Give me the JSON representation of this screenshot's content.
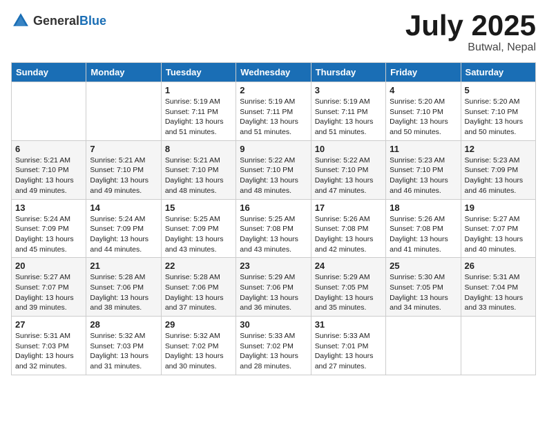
{
  "header": {
    "logo_general": "General",
    "logo_blue": "Blue",
    "month_year": "July 2025",
    "location": "Butwal, Nepal"
  },
  "calendar": {
    "days_of_week": [
      "Sunday",
      "Monday",
      "Tuesday",
      "Wednesday",
      "Thursday",
      "Friday",
      "Saturday"
    ],
    "weeks": [
      [
        {
          "day": "",
          "info": ""
        },
        {
          "day": "",
          "info": ""
        },
        {
          "day": "1",
          "info": "Sunrise: 5:19 AM\nSunset: 7:11 PM\nDaylight: 13 hours\nand 51 minutes."
        },
        {
          "day": "2",
          "info": "Sunrise: 5:19 AM\nSunset: 7:11 PM\nDaylight: 13 hours\nand 51 minutes."
        },
        {
          "day": "3",
          "info": "Sunrise: 5:19 AM\nSunset: 7:11 PM\nDaylight: 13 hours\nand 51 minutes."
        },
        {
          "day": "4",
          "info": "Sunrise: 5:20 AM\nSunset: 7:10 PM\nDaylight: 13 hours\nand 50 minutes."
        },
        {
          "day": "5",
          "info": "Sunrise: 5:20 AM\nSunset: 7:10 PM\nDaylight: 13 hours\nand 50 minutes."
        }
      ],
      [
        {
          "day": "6",
          "info": "Sunrise: 5:21 AM\nSunset: 7:10 PM\nDaylight: 13 hours\nand 49 minutes."
        },
        {
          "day": "7",
          "info": "Sunrise: 5:21 AM\nSunset: 7:10 PM\nDaylight: 13 hours\nand 49 minutes."
        },
        {
          "day": "8",
          "info": "Sunrise: 5:21 AM\nSunset: 7:10 PM\nDaylight: 13 hours\nand 48 minutes."
        },
        {
          "day": "9",
          "info": "Sunrise: 5:22 AM\nSunset: 7:10 PM\nDaylight: 13 hours\nand 48 minutes."
        },
        {
          "day": "10",
          "info": "Sunrise: 5:22 AM\nSunset: 7:10 PM\nDaylight: 13 hours\nand 47 minutes."
        },
        {
          "day": "11",
          "info": "Sunrise: 5:23 AM\nSunset: 7:10 PM\nDaylight: 13 hours\nand 46 minutes."
        },
        {
          "day": "12",
          "info": "Sunrise: 5:23 AM\nSunset: 7:09 PM\nDaylight: 13 hours\nand 46 minutes."
        }
      ],
      [
        {
          "day": "13",
          "info": "Sunrise: 5:24 AM\nSunset: 7:09 PM\nDaylight: 13 hours\nand 45 minutes."
        },
        {
          "day": "14",
          "info": "Sunrise: 5:24 AM\nSunset: 7:09 PM\nDaylight: 13 hours\nand 44 minutes."
        },
        {
          "day": "15",
          "info": "Sunrise: 5:25 AM\nSunset: 7:09 PM\nDaylight: 13 hours\nand 43 minutes."
        },
        {
          "day": "16",
          "info": "Sunrise: 5:25 AM\nSunset: 7:08 PM\nDaylight: 13 hours\nand 43 minutes."
        },
        {
          "day": "17",
          "info": "Sunrise: 5:26 AM\nSunset: 7:08 PM\nDaylight: 13 hours\nand 42 minutes."
        },
        {
          "day": "18",
          "info": "Sunrise: 5:26 AM\nSunset: 7:08 PM\nDaylight: 13 hours\nand 41 minutes."
        },
        {
          "day": "19",
          "info": "Sunrise: 5:27 AM\nSunset: 7:07 PM\nDaylight: 13 hours\nand 40 minutes."
        }
      ],
      [
        {
          "day": "20",
          "info": "Sunrise: 5:27 AM\nSunset: 7:07 PM\nDaylight: 13 hours\nand 39 minutes."
        },
        {
          "day": "21",
          "info": "Sunrise: 5:28 AM\nSunset: 7:06 PM\nDaylight: 13 hours\nand 38 minutes."
        },
        {
          "day": "22",
          "info": "Sunrise: 5:28 AM\nSunset: 7:06 PM\nDaylight: 13 hours\nand 37 minutes."
        },
        {
          "day": "23",
          "info": "Sunrise: 5:29 AM\nSunset: 7:06 PM\nDaylight: 13 hours\nand 36 minutes."
        },
        {
          "day": "24",
          "info": "Sunrise: 5:29 AM\nSunset: 7:05 PM\nDaylight: 13 hours\nand 35 minutes."
        },
        {
          "day": "25",
          "info": "Sunrise: 5:30 AM\nSunset: 7:05 PM\nDaylight: 13 hours\nand 34 minutes."
        },
        {
          "day": "26",
          "info": "Sunrise: 5:31 AM\nSunset: 7:04 PM\nDaylight: 13 hours\nand 33 minutes."
        }
      ],
      [
        {
          "day": "27",
          "info": "Sunrise: 5:31 AM\nSunset: 7:03 PM\nDaylight: 13 hours\nand 32 minutes."
        },
        {
          "day": "28",
          "info": "Sunrise: 5:32 AM\nSunset: 7:03 PM\nDaylight: 13 hours\nand 31 minutes."
        },
        {
          "day": "29",
          "info": "Sunrise: 5:32 AM\nSunset: 7:02 PM\nDaylight: 13 hours\nand 30 minutes."
        },
        {
          "day": "30",
          "info": "Sunrise: 5:33 AM\nSunset: 7:02 PM\nDaylight: 13 hours\nand 28 minutes."
        },
        {
          "day": "31",
          "info": "Sunrise: 5:33 AM\nSunset: 7:01 PM\nDaylight: 13 hours\nand 27 minutes."
        },
        {
          "day": "",
          "info": ""
        },
        {
          "day": "",
          "info": ""
        }
      ]
    ]
  }
}
